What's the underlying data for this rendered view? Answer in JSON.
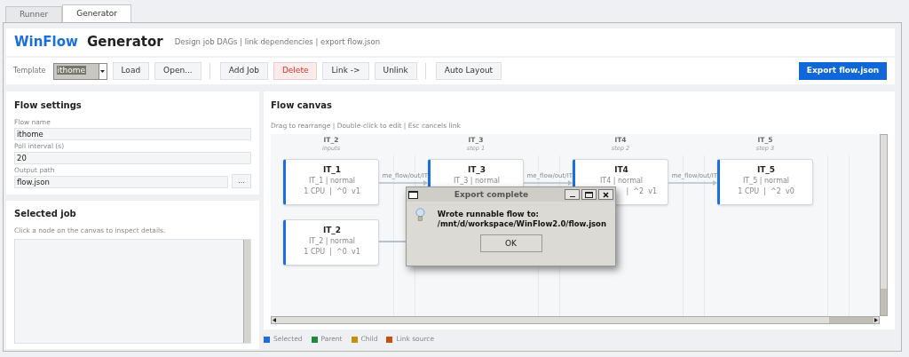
{
  "tabs": [
    {
      "label": "Runner",
      "selected": false
    },
    {
      "label": "Generator",
      "selected": true
    }
  ],
  "header": {
    "brand": "WinFlow",
    "title": "Generator",
    "subtitle": "Design job DAGs | link dependencies | export flow.json"
  },
  "toolbar": {
    "template_label": "Template",
    "template_value": "ithome",
    "button_groups": [
      [
        {
          "label": "Load",
          "kind": "normal"
        },
        {
          "label": "Open...",
          "kind": "normal"
        }
      ],
      [
        {
          "label": "Add Job",
          "kind": "normal"
        },
        {
          "label": "Delete",
          "kind": "danger"
        },
        {
          "label": "Link ->",
          "kind": "normal"
        },
        {
          "label": "Unlink",
          "kind": "normal"
        }
      ],
      [
        {
          "label": "Auto Layout",
          "kind": "normal"
        }
      ]
    ],
    "export_button": "Export flow.json"
  },
  "flow_settings": {
    "title": "Flow settings",
    "fields": [
      {
        "label": "Flow name",
        "value": "ithome"
      },
      {
        "label": "Poll interval (s)",
        "value": "20"
      },
      {
        "label": "Output path",
        "value": "flow.json",
        "browse": "..."
      }
    ]
  },
  "selected_job": {
    "title": "Selected job",
    "hint": "Click a node on the canvas to inspect details."
  },
  "canvas": {
    "title": "Flow canvas",
    "hint": "Drag to rearrange | Double-click to edit | Esc cancels link",
    "columns": [
      {
        "header": "IT_2",
        "sub": "inputs",
        "nodes": [
          {
            "title": "IT_1",
            "type": "IT_1 | normal",
            "meta": "1 CPU  |  ^0  v1",
            "partial": false
          },
          {
            "title": "IT_2",
            "type": "IT_2 | normal",
            "meta": "1 CPU  |  ^0  v1",
            "partial": false
          }
        ]
      },
      {
        "header": "IT_3",
        "sub": "step 1",
        "nodes": [
          {
            "title": "IT_3",
            "type": "IT_3 | normal"
          }
        ]
      },
      {
        "header": "IT4",
        "sub": "step 2",
        "nodes": [
          {
            "title": "IT4",
            "type": "IT4 | normal",
            "meta": "|  ^2  v1",
            "partial": true
          }
        ]
      },
      {
        "header": "IT_5",
        "sub": "step 3",
        "nodes": [
          {
            "title": "IT_5",
            "type": "IT_5 | normal",
            "meta": "1 CPU  |  ^2  v0",
            "partial": false
          }
        ]
      }
    ],
    "edges": [
      {
        "label": "me_flow/out/IT"
      },
      {
        "label": "me_flow/out/IT"
      },
      {
        "label": "me_flow/out/IT"
      }
    ]
  },
  "legend": [
    {
      "label": "Selected",
      "color": "#1a6fdc"
    },
    {
      "label": "Parent",
      "color": "#1e8a3e"
    },
    {
      "label": "Child",
      "color": "#c8900a"
    },
    {
      "label": "Link source",
      "color": "#c9500c"
    }
  ],
  "dialog": {
    "title": "Export complete",
    "message": "Wrote runnable flow to:\n/mnt/d/workspace/WinFlow2.0/flow.json",
    "ok": "OK"
  }
}
